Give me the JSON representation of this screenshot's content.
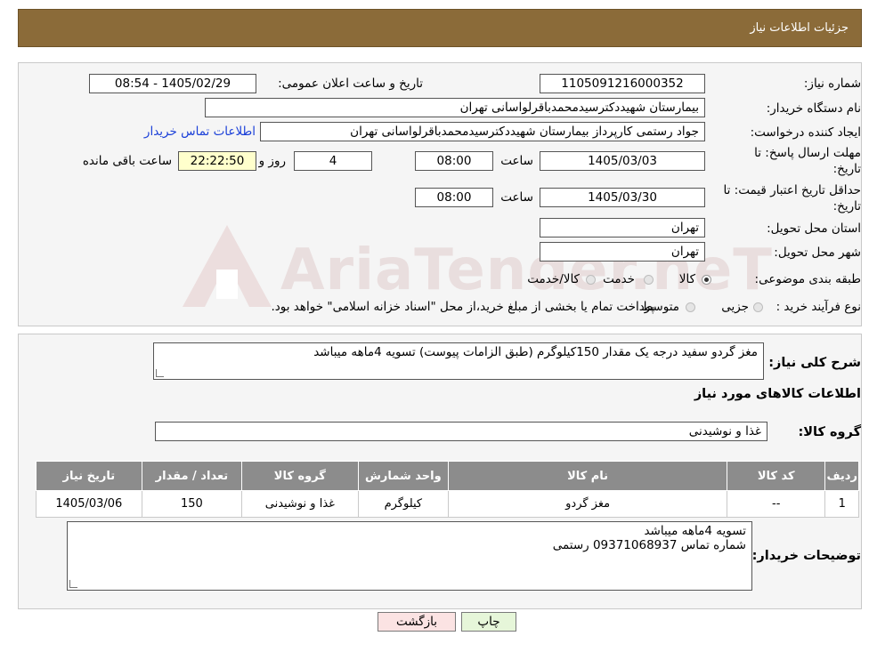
{
  "header": {
    "title": "جزئیات اطلاعات نیاز"
  },
  "form": {
    "need_number_label": "شماره نیاز:",
    "need_number": "1105091216000352",
    "announce_label": "تاریخ و ساعت اعلان عمومی:",
    "announce_value": "1405/02/29 - 08:54",
    "buyer_org_label": "نام دستگاه خریدار:",
    "buyer_org": "بیمارستان شهیددکترسیدمحمدباقرلواسانی تهران",
    "creator_label": "ایجاد کننده درخواست:",
    "creator": "جواد رستمی کارپرداز بیمارستان شهیددکترسیدمحمدباقرلواسانی تهران",
    "contact_link": "اطلاعات تماس خریدار",
    "deadline_label_1": "مهلت ارسال پاسخ: تا",
    "deadline_label_2": "تاریخ:",
    "deadline_date": "1405/03/03",
    "time_label": "ساعت",
    "deadline_time": "08:00",
    "days_value": "4",
    "days_label": "روز و",
    "remaining_time": "22:22:50",
    "remaining_label": "ساعت باقی مانده",
    "validity_label_1": "حداقل تاریخ اعتبار قیمت: تا",
    "validity_label_2": "تاریخ:",
    "validity_date": "1405/03/30",
    "validity_time": "08:00",
    "province_label": "استان محل تحویل:",
    "province": "تهران",
    "city_label": "شهر محل تحویل:",
    "city": "تهران",
    "category_label": "طبقه بندی موضوعی:",
    "category_options": [
      "کالا",
      "خدمت",
      "کالا/خدمت"
    ],
    "process_label": "نوع فرآیند خرید :",
    "process_options": [
      "جزیی",
      "متوسط"
    ],
    "process_note": "پرداخت تمام یا بخشی از مبلغ خرید،از محل \"اسناد خزانه اسلامی\" خواهد بود."
  },
  "description": {
    "label": "شرح کلی نیاز:",
    "value": "مغز گردو سفید درجه یک مقدار 150کیلوگرم (طبق الزامات پیوست) تسویه 4ماهه میباشد"
  },
  "goods": {
    "section_title": "اطلاعات کالاهای مورد نیاز",
    "group_label": "گروه کالا:",
    "group_value": "غذا و نوشیدنی",
    "columns": [
      "ردیف",
      "کد کالا",
      "نام کالا",
      "واحد شمارش",
      "گروه کالا",
      "تعداد / مقدار",
      "تاریخ نیاز"
    ],
    "rows": [
      [
        "1",
        "--",
        "مغز گردو",
        "کیلوگرم",
        "غذا و نوشیدنی",
        "150",
        "1405/03/06"
      ]
    ]
  },
  "buyer_notes": {
    "label": "توضیحات خریدار:",
    "line1": "تسویه 4ماهه میباشد",
    "line2": "شماره تماس 09371068937 رستمی"
  },
  "buttons": {
    "print": "چاپ",
    "back": "بازگشت"
  },
  "watermark": "AriaTender.neT",
  "colors": {
    "header": "#8b6b39",
    "table_header": "#8c8c8c",
    "highlight": "#ffffcc",
    "link": "#1a3fd8"
  }
}
